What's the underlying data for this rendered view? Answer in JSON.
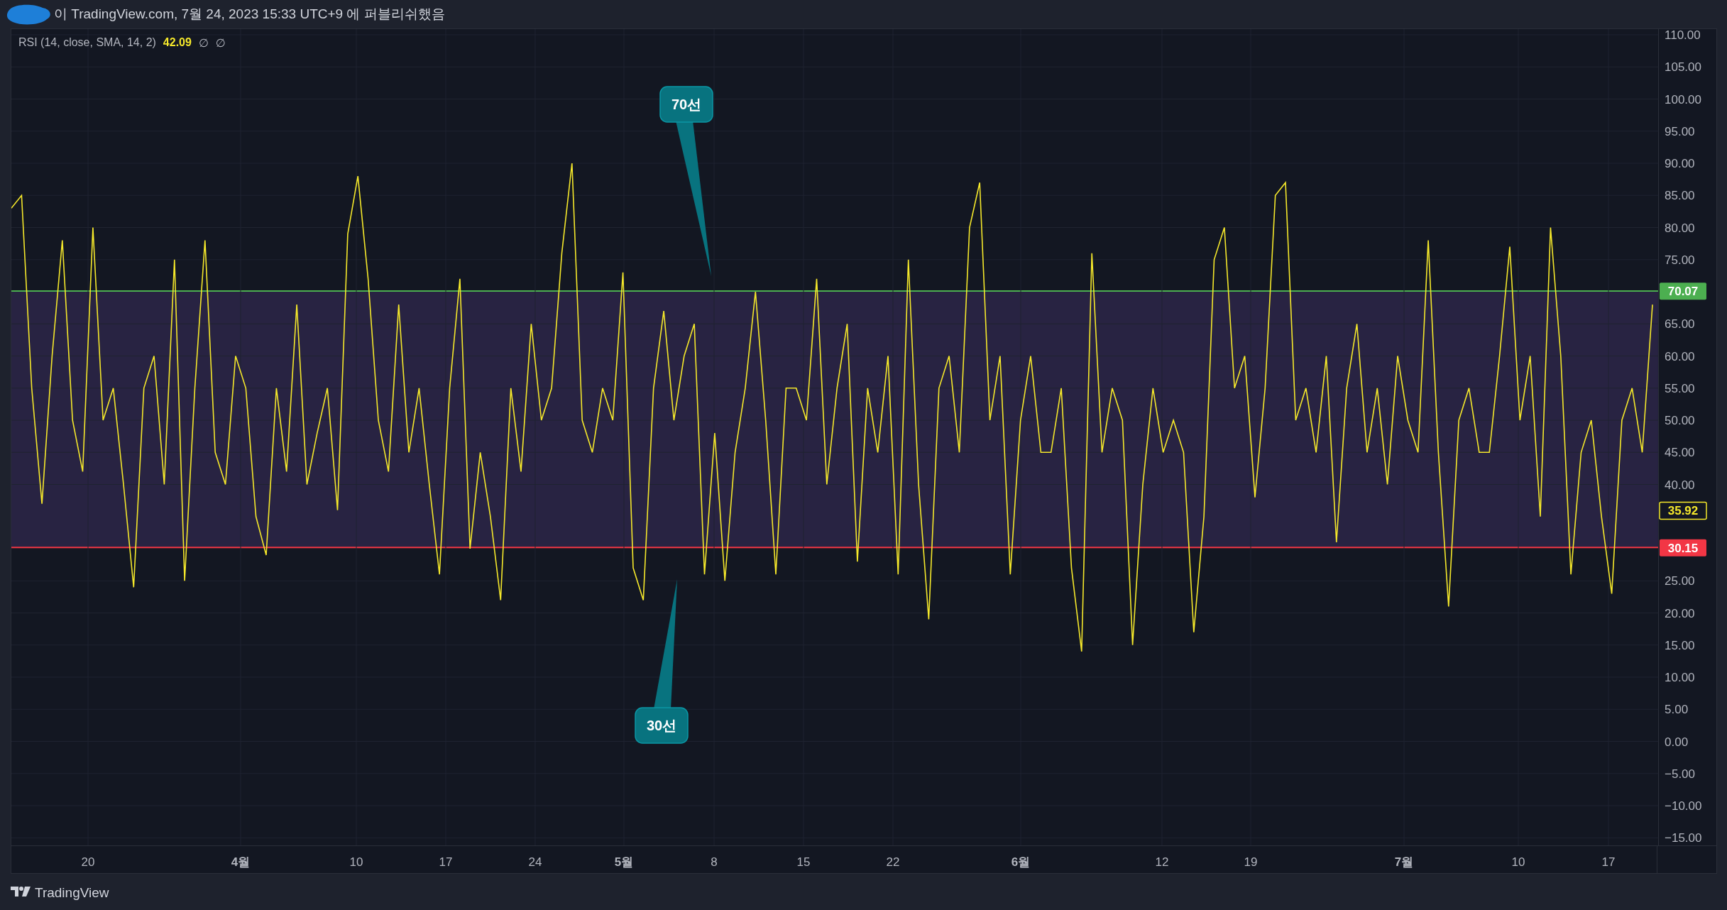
{
  "header": {
    "publisher_note": "이 TradingView.com, 7월 24, 2023 15:33 UTC+9 에 퍼블리쉬했음"
  },
  "legend": {
    "title": "RSI (14, close, SMA, 14, 2)",
    "value": "42.09",
    "extras": [
      "∅",
      "∅"
    ]
  },
  "callouts": [
    {
      "label": "70선",
      "kind": "above"
    },
    {
      "label": "30선",
      "kind": "below"
    }
  ],
  "chart_data": {
    "type": "line",
    "ylim": [
      -15,
      110
    ],
    "grid": true,
    "yticks": [
      {
        "value": 110,
        "label": "110.00"
      },
      {
        "value": 105,
        "label": "105.00"
      },
      {
        "value": 100,
        "label": "100.00"
      },
      {
        "value": 95,
        "label": "95.00"
      },
      {
        "value": 90,
        "label": "90.00"
      },
      {
        "value": 85,
        "label": "85.00"
      },
      {
        "value": 80,
        "label": "80.00"
      },
      {
        "value": 75,
        "label": "75.00"
      },
      {
        "value": 65,
        "label": "65.00"
      },
      {
        "value": 60,
        "label": "60.00"
      },
      {
        "value": 55,
        "label": "55.00"
      },
      {
        "value": 50,
        "label": "50.00"
      },
      {
        "value": 45,
        "label": "45.00"
      },
      {
        "value": 40,
        "label": "40.00"
      },
      {
        "value": 25,
        "label": "25.00"
      },
      {
        "value": 20,
        "label": "20.00"
      },
      {
        "value": 15,
        "label": "15.00"
      },
      {
        "value": 10,
        "label": "10.00"
      },
      {
        "value": 5,
        "label": "5.00"
      },
      {
        "value": 0,
        "label": "0.00"
      },
      {
        "value": -5,
        "label": "−5.00"
      },
      {
        "value": -10,
        "label": "−10.00"
      },
      {
        "value": -15,
        "label": "−15.00"
      }
    ],
    "series": [
      {
        "color": "#f5e82b",
        "values": [
          83,
          85,
          55,
          37,
          60,
          78,
          50,
          42,
          80,
          50,
          55,
          40,
          24,
          55,
          60,
          40,
          75,
          25,
          55,
          78,
          45,
          40,
          60,
          55,
          35,
          29,
          55,
          42,
          68,
          40,
          48,
          55,
          36,
          79,
          88,
          72,
          50,
          42,
          68,
          45,
          55,
          40,
          26,
          55,
          72,
          30,
          45,
          35,
          22,
          55,
          42,
          65,
          50,
          55,
          76,
          90,
          50,
          45,
          55,
          50,
          73,
          27,
          22,
          55,
          67,
          50,
          60,
          65,
          26,
          48,
          25,
          45,
          55,
          70,
          50,
          26,
          55,
          55,
          50,
          72,
          40,
          55,
          65,
          28,
          55,
          45,
          60,
          26,
          75,
          40,
          19,
          55,
          60,
          45,
          80,
          87,
          50,
          60,
          26,
          50,
          60,
          45,
          45,
          55,
          27,
          14,
          76,
          45,
          55,
          50,
          15,
          40,
          55,
          45,
          50,
          45,
          17,
          35,
          75,
          80,
          55,
          60,
          38,
          55,
          85,
          87,
          50,
          55,
          45,
          60,
          31,
          55,
          65,
          45,
          55,
          40,
          60,
          50,
          45,
          78,
          45,
          21,
          50,
          55,
          45,
          45,
          60,
          77,
          50,
          60,
          35,
          80,
          60,
          26,
          45,
          50,
          35,
          23,
          50,
          55,
          45,
          68
        ]
      }
    ]
  },
  "price_axis": {
    "badges": [
      {
        "label": "70.07",
        "kind": "upper-band"
      },
      {
        "label": "35.92",
        "kind": "last-value"
      },
      {
        "label": "30.15",
        "kind": "lower-band"
      }
    ]
  },
  "time_axis": {
    "labels": [
      {
        "text": "20",
        "kind": "day"
      },
      {
        "text": "4월",
        "kind": "month"
      },
      {
        "text": "10",
        "kind": "day"
      },
      {
        "text": "17",
        "kind": "day"
      },
      {
        "text": "24",
        "kind": "day"
      },
      {
        "text": "5월",
        "kind": "month"
      },
      {
        "text": "8",
        "kind": "day"
      },
      {
        "text": "15",
        "kind": "day"
      },
      {
        "text": "22",
        "kind": "day"
      },
      {
        "text": "6월",
        "kind": "month"
      },
      {
        "text": "12",
        "kind": "day"
      },
      {
        "text": "19",
        "kind": "day"
      },
      {
        "text": "7월",
        "kind": "month"
      },
      {
        "text": "10",
        "kind": "day"
      },
      {
        "text": "17",
        "kind": "day"
      }
    ]
  },
  "footer": {
    "brand": "TradingView"
  }
}
